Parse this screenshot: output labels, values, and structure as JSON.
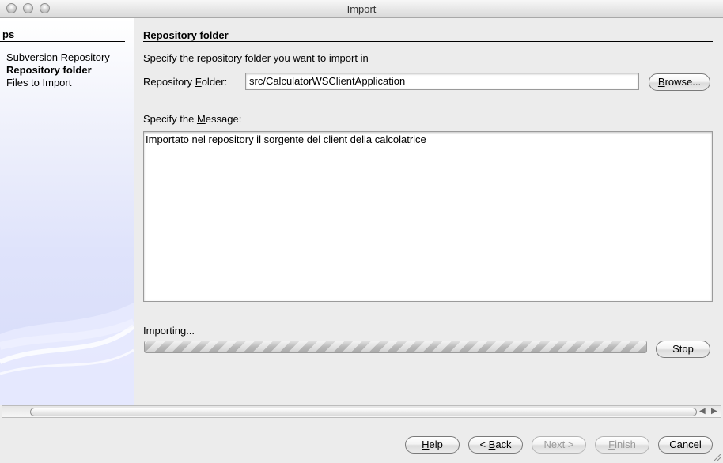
{
  "window": {
    "title": "Import"
  },
  "steps": {
    "title": "ps",
    "items": [
      {
        "label": "Subversion Repository",
        "bold": false
      },
      {
        "label": "Repository folder",
        "bold": true
      },
      {
        "label": "Files to Import",
        "bold": false
      }
    ]
  },
  "section": {
    "title": "Repository folder",
    "instruction": "Specify the repository folder you want to import in"
  },
  "folder": {
    "label_pre": "Repository ",
    "label_mnemonic": "F",
    "label_post": "older:",
    "value": "src/CalculatorWSClientApplication",
    "browse_mnemonic": "B",
    "browse_rest": "rowse..."
  },
  "message": {
    "label_pre": "Specify the ",
    "label_mnemonic": "M",
    "label_post": "essage:",
    "value": "Importato nel repository il sorgente del client della calcolatrice"
  },
  "progress": {
    "label": "Importing...",
    "stop_label": "Stop"
  },
  "footer": {
    "help": {
      "mnemonic": "H",
      "rest": "elp"
    },
    "back": {
      "pre": "< ",
      "mnemonic": "B",
      "rest": "ack"
    },
    "next": {
      "label": "Next >"
    },
    "finish": {
      "mnemonic": "F",
      "rest": "inish"
    },
    "cancel": {
      "label": "Cancel"
    }
  }
}
